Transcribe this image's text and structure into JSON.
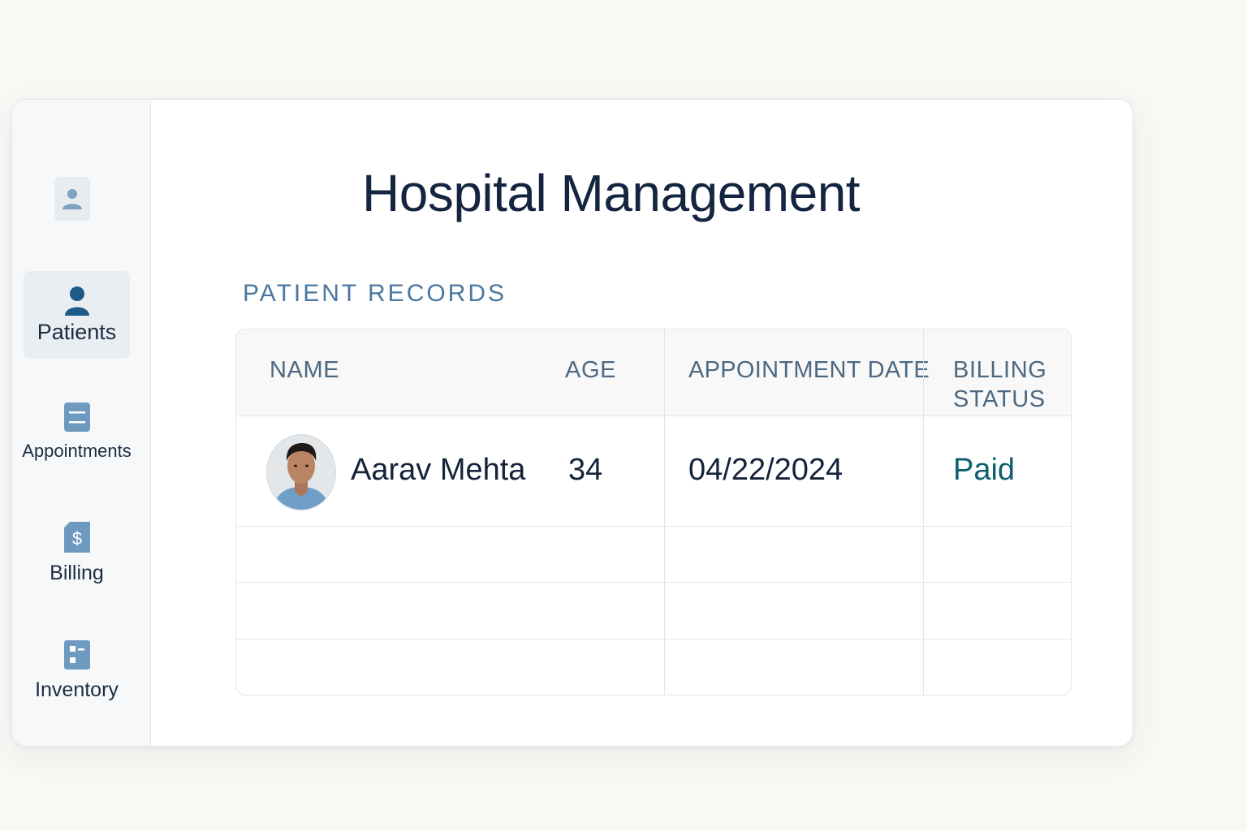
{
  "app": {
    "title": "Hospital Management"
  },
  "sidebar": {
    "profile_icon": "user-icon",
    "items": [
      {
        "label": "Patients",
        "icon": "patient-icon",
        "active": true
      },
      {
        "label": "Appointments",
        "icon": "appointments-icon",
        "active": false
      },
      {
        "label": "Billing",
        "icon": "billing-icon",
        "active": false
      },
      {
        "label": "Inventory",
        "icon": "inventory-icon",
        "active": false
      }
    ]
  },
  "main": {
    "section_title": "PATIENT RECORDS",
    "table": {
      "headers": {
        "name": "NAME",
        "age": "AGE",
        "appointment_date": "APPOINTMENT DATE",
        "billing_line1": "BILLING",
        "billing_line2": "STATUS"
      },
      "rows": [
        {
          "name": "Aarav Mehta",
          "age": "34",
          "appointment_date": "04/22/2024",
          "billing_status": "Paid"
        }
      ],
      "empty_rows": 3
    }
  },
  "colors": {
    "primary": "#1e5a86",
    "icon_muted": "#7da2c2",
    "paid_status": "#0d5f6e",
    "title": "#13253f",
    "section_title": "#4a78a0"
  }
}
